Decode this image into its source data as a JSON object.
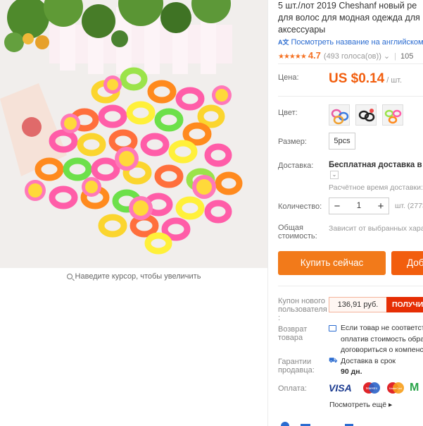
{
  "gallery": {
    "zoom_hint": "Наведите курсор, чтобы увеличить"
  },
  "product": {
    "title_lines": [
      "5 шт./лот 2019 Cheshanf новый ре",
      "для волос для модная одежда для",
      "аксессуары"
    ],
    "translate_link": "Посмотреть название на английском",
    "rating": {
      "stars": "★★★★★",
      "score": "4.7",
      "votes": "(493 голоса(ов))",
      "orders": "105"
    }
  },
  "fields": {
    "price_label": "Цена:",
    "price": "US $0.14",
    "price_unit": "/ шт.",
    "color_label": "Цвет:",
    "size_label": "Размер:",
    "size_value": "5pcs",
    "shipping_label": "Доставка:",
    "shipping_main": "Бесплатная доставка в Ru",
    "shipping_est": "Расчётное время доставки:",
    "qty_label": "Количество:",
    "qty_minus": "−",
    "qty_value": "1",
    "qty_plus": "+",
    "qty_note": "шт. (2773",
    "total_label_1": "Общая",
    "total_label_2": "стоимость:",
    "total_note": "Зависит от выбранных хара"
  },
  "actions": {
    "buy_now": "Купить сейчас",
    "add_cart": "Доб"
  },
  "coupon": {
    "label_lines": [
      "Купон нового",
      "пользователя",
      ":"
    ],
    "value": "136,91 руб.",
    "get": "ПОЛУЧИ"
  },
  "returns": {
    "label_lines": [
      "Возврат",
      "товара"
    ],
    "lines": [
      "Если товар не соответст",
      "оплатив стоимость обра",
      "договориться о компенс"
    ]
  },
  "guarantee": {
    "label_lines": [
      "Гарантии",
      "продавца:"
    ],
    "line1": "Доставка в срок",
    "line2": "90 дн."
  },
  "payment": {
    "label": "Оплата:",
    "visa": "VISA",
    "maestro": "Maestro",
    "mastercard": "MasterCard",
    "see_more": "Посмотреть ещё"
  },
  "colors": {
    "accent": "#f25e0e",
    "buy_button": "#f27a1a",
    "coupon": "#e62e04",
    "link": "#2a6bd0"
  }
}
